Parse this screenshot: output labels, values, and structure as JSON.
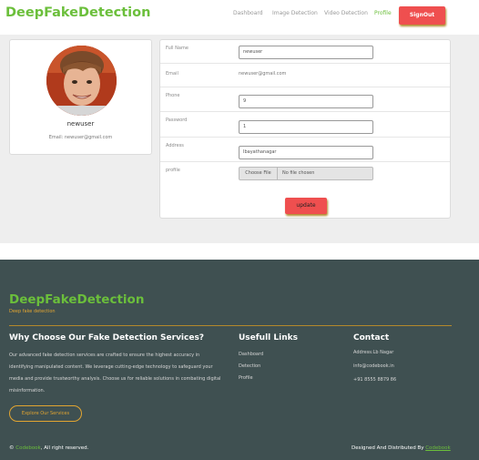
{
  "header": {
    "brand": "DeepFakeDetection",
    "nav": [
      "Dashboard",
      "Image Detection",
      "Video Detection",
      "Profile"
    ],
    "signout": "SignOut"
  },
  "profile_card": {
    "name": "newuser",
    "email_line": "Email: newuser@gmail.com"
  },
  "form": {
    "fullname_label": "Full Name",
    "fullname_value": "newuser",
    "email_label": "Email",
    "email_value": "newuser@gmail.com",
    "phone_label": "Phone",
    "phone_value": "9",
    "password_label": "Password",
    "password_value": "1",
    "address_label": "Address",
    "address_value": "Ibayathanagar",
    "profile_label": "profile",
    "file_button": "Choose File",
    "file_status": "No file chosen",
    "update_label": "update"
  },
  "footer": {
    "brand": "DeepFakeDetection",
    "tagline": "Deep fake detection",
    "why_heading": "Why Choose Our Fake Detection Services?",
    "why_text": "Our advanced fake detection services are crafted to ensure the highest accuracy in identifying manipulated content. We leverage cutting-edge technology to safeguard your media and provide trustworthy analysis. Choose us for reliable solutions in combating digital misinformation.",
    "links_heading": "Usefull Links",
    "links": [
      "Dashboard",
      "Detection",
      "Profile"
    ],
    "contact_heading": "Contact",
    "address": "Address:Lb Nagar",
    "email": "info@codebook.in",
    "phone": "+91 8555 8879 86",
    "explore_button": "Explore Our Services",
    "copyright_symbol": "©",
    "copyright_brand": "Codebook",
    "copyright_rest": ", All right reserved.",
    "designed_prefix": "Designed And Distributed By",
    "designed_brand": "Codebook"
  },
  "colors": {
    "brand_green": "#6bbf3b",
    "signout_red": "#ef4f4f",
    "footer_bg": "#3f5051",
    "accent_gold": "#e2a531"
  }
}
